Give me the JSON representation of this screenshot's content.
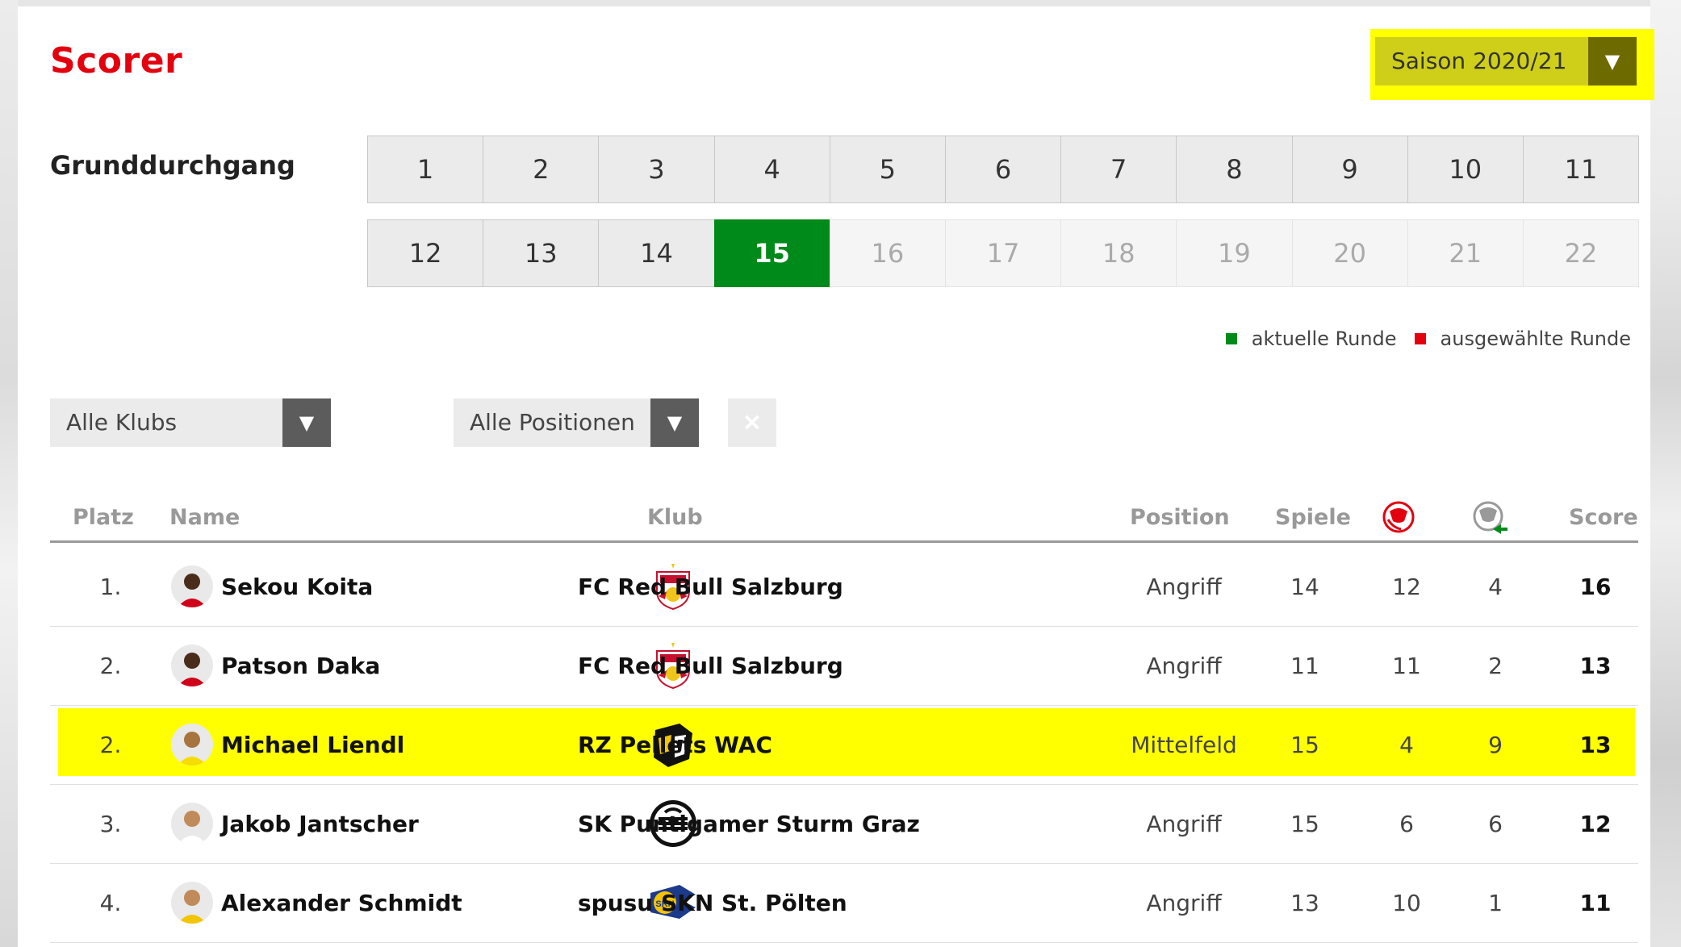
{
  "title": "Scorer",
  "season": {
    "label": "Saison 2020/21",
    "arrow": "▼"
  },
  "round_label": "Grunddurchgang",
  "rounds_row1": [
    "1",
    "2",
    "3",
    "4",
    "5",
    "6",
    "7",
    "8",
    "9",
    "10",
    "11"
  ],
  "rounds_row2": [
    "12",
    "13",
    "14",
    "15",
    "16",
    "17",
    "18",
    "19",
    "20",
    "21",
    "22"
  ],
  "current_round": "15",
  "legend": {
    "current": "aktuelle Runde",
    "current_color": "#008a19",
    "selected": "ausgewählte Runde",
    "selected_color": "#e3000f"
  },
  "filters": {
    "clubs": "Alle Klubs",
    "positions": "Alle Positionen",
    "arrow": "▼",
    "clear": "×"
  },
  "table": {
    "headers": {
      "platz": "Platz",
      "name": "Name",
      "klub": "Klub",
      "position": "Position",
      "spiele": "Spiele",
      "goals_icon": "goal-ball-icon",
      "assists_icon": "assist-ball-icon",
      "score": "Score"
    },
    "rows": [
      {
        "platz": "1.",
        "name": "Sekou Koita",
        "klub": "FC Red Bull Salzburg",
        "crest": "red-bull-salzburg-crest",
        "position": "Angriff",
        "spiele": "14",
        "tore": "12",
        "assists": "4",
        "score": "16",
        "highlight": false
      },
      {
        "platz": "2.",
        "name": "Patson Daka",
        "klub": "FC Red Bull Salzburg",
        "crest": "red-bull-salzburg-crest",
        "position": "Angriff",
        "spiele": "11",
        "tore": "11",
        "assists": "2",
        "score": "13",
        "highlight": false
      },
      {
        "platz": "2.",
        "name": "Michael Liendl",
        "klub": "RZ Pellets WAC",
        "crest": "wac-crest",
        "position": "Mittelfeld",
        "spiele": "15",
        "tore": "4",
        "assists": "9",
        "score": "13",
        "highlight": true
      },
      {
        "platz": "3.",
        "name": "Jakob Jantscher",
        "klub": "SK Puntigamer Sturm Graz",
        "crest": "sturm-graz-crest",
        "position": "Angriff",
        "spiele": "15",
        "tore": "6",
        "assists": "6",
        "score": "12",
        "highlight": false
      },
      {
        "platz": "4.",
        "name": "Alexander Schmidt",
        "klub": "spusu SKN St. Pölten",
        "crest": "skn-st-poelten-crest",
        "position": "Angriff",
        "spiele": "13",
        "tore": "10",
        "assists": "1",
        "score": "11",
        "highlight": false
      }
    ]
  },
  "colors": {
    "accent_red": "#e3000f",
    "highlight_yellow": "#ffff00",
    "current_green": "#008a19"
  }
}
